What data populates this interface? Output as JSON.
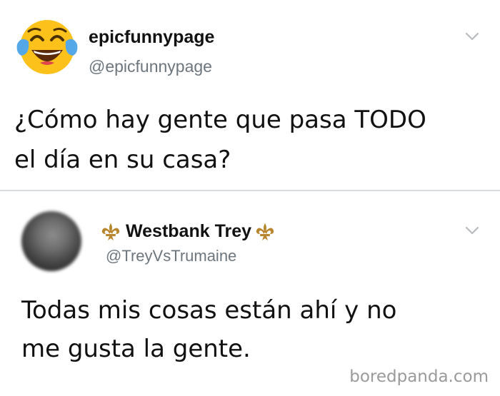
{
  "tweets": [
    {
      "display_name": "epicfunnypage",
      "handle": "@epicfunnypage",
      "avatar_icon": "tears-of-joy-emoji-icon",
      "text_lines": [
        "¿Cómo hay gente que pasa TODO",
        "el día en su casa?"
      ]
    },
    {
      "display_name": "Westbank Trey",
      "handle": "@TreyVsTrumaine",
      "avatar_icon": "blurred-profile-photo",
      "name_decoration_icon": "fleur-de-lis-icon",
      "text_lines": [
        "Todas mis cosas están ahí y no",
        "me gusta la gente."
      ]
    }
  ],
  "watermark": "boredpanda.com",
  "colors": {
    "handle": "#6e767d",
    "text": "#111111",
    "divider": "#d8dcdf",
    "emoji_face": "#fcc21b",
    "emoji_tears": "#55a8e8",
    "fleur": "#b8862e"
  }
}
